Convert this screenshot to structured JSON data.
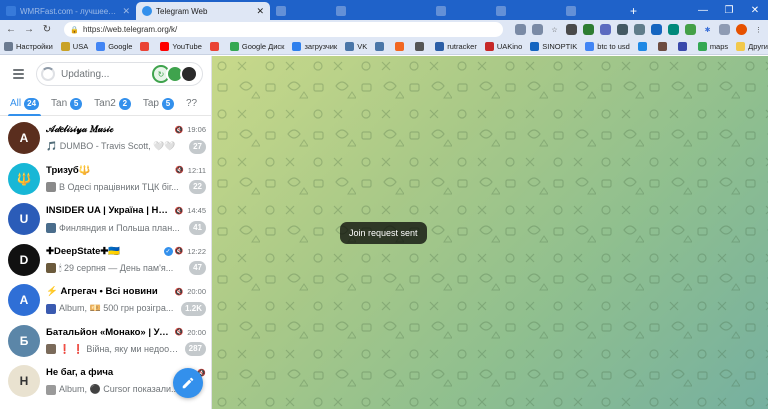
{
  "browser": {
    "tabs": [
      {
        "title": "WMRFast.com - лучшее место для",
        "active": false,
        "color": "#4c8ee8"
      },
      {
        "title": "Telegram Web",
        "active": true,
        "color": "#3390ec"
      },
      {
        "title": "",
        "active": false,
        "color": "#9bb6e3"
      },
      {
        "title": "",
        "active": false,
        "color": "#9bb6e3"
      },
      {
        "title": "",
        "active": false,
        "color": "#9bb6e3"
      },
      {
        "title": "",
        "active": false,
        "color": "#9bb6e3"
      },
      {
        "title": "",
        "active": false,
        "color": "#9bb6e3"
      }
    ],
    "url": "https://web.telegram.org/k/",
    "bookmarks": [
      {
        "label": "Настройки",
        "color": "#6b7a90"
      },
      {
        "label": "USA",
        "color": "#c9a227"
      },
      {
        "label": "Google",
        "color": "#4285f4"
      },
      {
        "label": "",
        "color": "#ea4335"
      },
      {
        "label": "YouTube",
        "color": "#ff0000"
      },
      {
        "label": "",
        "color": "#ea4335"
      },
      {
        "label": "Google Диск",
        "color": "#34a853"
      },
      {
        "label": "загрузчик",
        "color": "#2f80ed"
      },
      {
        "label": "VK",
        "color": "#4a76a8"
      },
      {
        "label": "",
        "color": "#4a76a8"
      },
      {
        "label": "",
        "color": "#f26722"
      },
      {
        "label": "",
        "color": "#555555"
      },
      {
        "label": "rutracker",
        "color": "#2b5ea7"
      },
      {
        "label": "UAKino",
        "color": "#c62828"
      },
      {
        "label": "SINOPTIK",
        "color": "#1565c0"
      },
      {
        "label": "btc to usd",
        "color": "#4285f4"
      },
      {
        "label": "",
        "color": "#1e88e5"
      },
      {
        "label": "",
        "color": "#6d4c41"
      },
      {
        "label": "",
        "color": "#3949ab"
      },
      {
        "label": "maps",
        "color": "#34a853"
      }
    ],
    "other_bookmarks": "Другие закладки"
  },
  "telegram": {
    "search_placeholder": "Updating...",
    "folders": [
      {
        "label": "All",
        "badge": "24",
        "active": true
      },
      {
        "label": "Tan",
        "badge": "5",
        "active": false
      },
      {
        "label": "Tan2",
        "badge": "2",
        "active": false
      },
      {
        "label": "Tap",
        "badge": "5",
        "active": false
      },
      {
        "label": "??",
        "badge": "",
        "active": false
      }
    ],
    "chats": [
      {
        "title": "𝒜𝒹𝑒𝓁𝒾𝓈𝒾𝓎𝒶 𝑀𝓊𝓈𝒾𝒸",
        "time": "19:06",
        "preview": "🎵 DUMBO - Travis Scott, 🤍🤍",
        "count": "27",
        "avatar_color": "#5a2e1e",
        "avatar_text": "A",
        "thumb_color": "",
        "verified": false
      },
      {
        "title": "Тризуб🔱",
        "time": "12:11",
        "preview": "В Одесі працівники ТЦК біг...",
        "count": "22",
        "avatar_color": "#18b7d6",
        "avatar_text": "🔱",
        "thumb_color": "#8a8a8a",
        "verified": false
      },
      {
        "title": "INSIDER UA | Україна | Новини",
        "time": "14:45",
        "preview": "Финляндия и Польша план...",
        "count": "41",
        "avatar_color": "#2b5cb8",
        "avatar_text": "U",
        "thumb_color": "#4a6d8c",
        "verified": false
      },
      {
        "title": "✚DeepState✚🇺🇦",
        "time": "12:22",
        "preview": "🕯 29 серпня — День пам'я...",
        "count": "47",
        "avatar_color": "#111111",
        "avatar_text": "D",
        "thumb_color": "#6b5a3c",
        "verified": true
      },
      {
        "title": "⚡ Агрегач • Всі новини",
        "time": "20:00",
        "preview": "Album, 💴 500 грн розігра...",
        "count": "1.2K",
        "avatar_color": "#2f6fd6",
        "avatar_text": "A",
        "thumb_color": "#3a5ab0",
        "verified": false
      },
      {
        "title": "Батальйон «Монако» | Украї...",
        "time": "20:00",
        "preview": "❗ ❗ Війна, яку ми недооці...",
        "count": "287",
        "avatar_color": "#5b86a8",
        "avatar_text": "Б",
        "thumb_color": "#7a6a5a",
        "verified": false
      },
      {
        "title": "Не баг, а фича",
        "time": "",
        "preview": "Album, ⚫ Cursor показали...",
        "count": "",
        "avatar_color": "#e9e2d0",
        "avatar_text": "Н",
        "thumb_color": "#9a9a9a",
        "verified": false
      }
    ],
    "toast": "Join request sent"
  },
  "colors": {
    "accent": "#3390ec",
    "chrome": "#1f62c9"
  }
}
